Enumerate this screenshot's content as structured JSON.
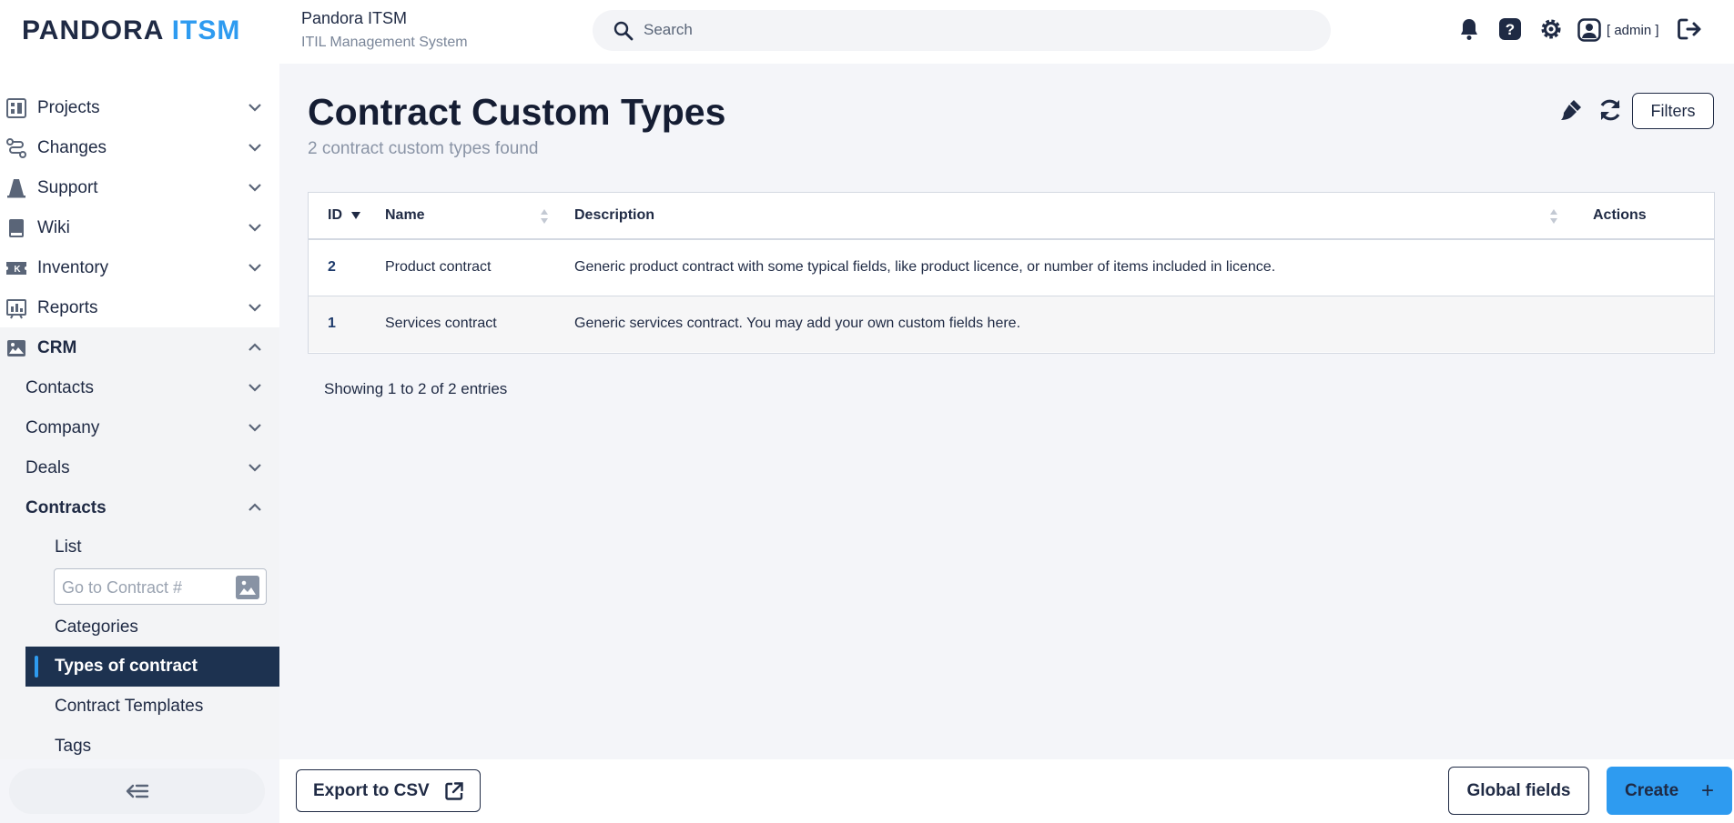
{
  "header": {
    "logo_main": "PANDORA",
    "logo_accent": "ITSM",
    "app_name": "Pandora ITSM",
    "app_subtitle": "ITIL Management System",
    "search_placeholder": "Search",
    "user_label": "[ admin ]"
  },
  "sidebar": {
    "items": [
      {
        "label": "Projects",
        "icon": "projects-icon"
      },
      {
        "label": "Changes",
        "icon": "changes-icon"
      },
      {
        "label": "Support",
        "icon": "support-icon"
      },
      {
        "label": "Wiki",
        "icon": "wiki-icon"
      },
      {
        "label": "Inventory",
        "icon": "inventory-icon"
      },
      {
        "label": "Reports",
        "icon": "reports-icon"
      },
      {
        "label": "CRM",
        "icon": "crm-icon"
      }
    ],
    "crm_subitems": [
      "Contacts",
      "Company",
      "Deals",
      "Contracts"
    ],
    "contracts_leaves": {
      "list": "List",
      "goto_placeholder": "Go to Contract #",
      "categories": "Categories",
      "types": "Types of contract",
      "templates": "Contract Templates",
      "tags": "Tags"
    }
  },
  "main": {
    "title": "Contract Custom Types",
    "subtitle": "2 contract custom types found",
    "filters_label": "Filters",
    "table": {
      "headers": [
        "ID",
        "Name",
        "Description",
        "Actions"
      ],
      "rows": [
        {
          "id": "2",
          "name": "Product contract",
          "description": "Generic product contract with some typical fields, like product licence, or number of items included in licence."
        },
        {
          "id": "1",
          "name": "Services contract",
          "description": "Generic services contract. You may add your own custom fields here."
        }
      ]
    },
    "showing": "Showing 1 to 2 of 2 entries"
  },
  "footer": {
    "export_label": "Export to CSV",
    "global_fields_label": "Global fields",
    "create_label": "Create"
  },
  "colors": {
    "accent": "#2e9bf0",
    "navy": "#1d3250",
    "text": "#1f2a44"
  }
}
